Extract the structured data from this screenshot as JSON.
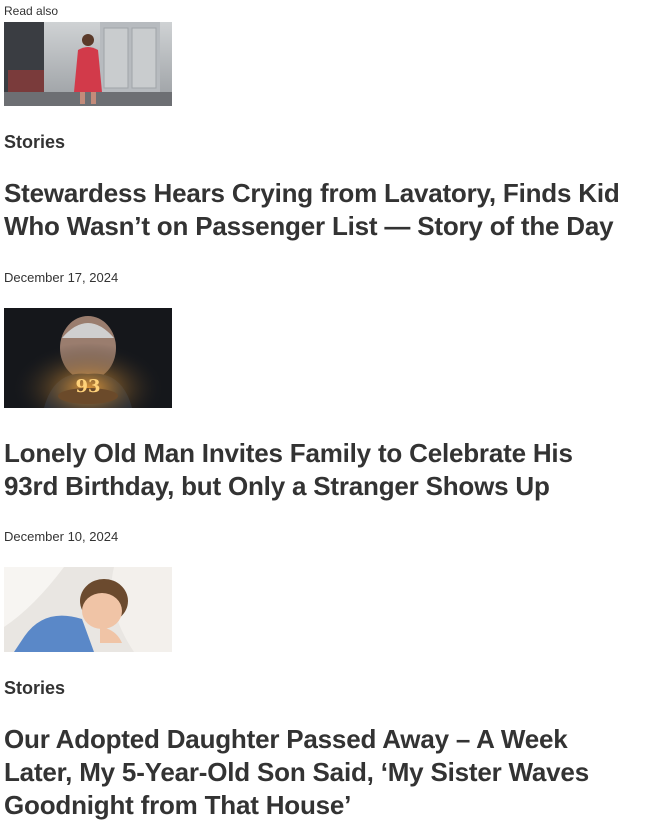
{
  "read_also_label": "Read also",
  "articles": [
    {
      "category": "Stories",
      "title": "Stewardess Hears Crying from Lavatory, Finds Kid Who Wasn’t on Passenger List — Story of the Day",
      "date": "December 17, 2024",
      "thumb_icon": "flight-attendant-image"
    },
    {
      "category": "",
      "title": "Lonely Old Man Invites Family to Celebrate His 93rd Birthday, but Only a Stranger Shows Up",
      "date": "December 10, 2024",
      "thumb_icon": "old-man-birthday-cake-image",
      "cake_text": "93"
    },
    {
      "category": "Stories",
      "title": "Our Adopted Daughter Passed Away – A Week Later, My 5-Year-Old Son Said, ‘My Sister Waves Goodnight from That House’",
      "thumb_icon": "sleeping-child-image"
    }
  ]
}
